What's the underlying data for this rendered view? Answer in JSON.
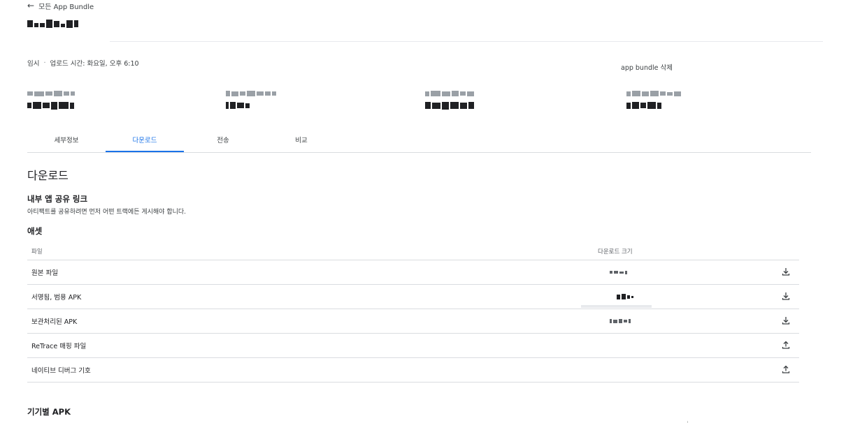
{
  "header": {
    "back_label": "모든 App Bundle",
    "back_icon": "arrow-left-icon"
  },
  "meta": {
    "status": "임시",
    "separator": "·",
    "upload_time": "업로드 시간: 화요일, 오후 6:10"
  },
  "actions": {
    "delete_bundle": "app bundle 삭제"
  },
  "tabs": [
    {
      "label": "세부정보",
      "active": false
    },
    {
      "label": "다운로드",
      "active": true
    },
    {
      "label": "전송",
      "active": false
    },
    {
      "label": "비교",
      "active": false
    }
  ],
  "downloads": {
    "title": "다운로드",
    "share_link": {
      "title": "내부 앱 공유 링크",
      "description": "아티팩트를 공유하려면 먼저 어떤 트랙에든 게시해야 합니다."
    },
    "assets": {
      "title": "애셋",
      "columns": {
        "file": "파일",
        "download_size": "다운로드 크기"
      },
      "rows": [
        {
          "name": "원본 파일",
          "action_icon": "download-icon"
        },
        {
          "name": "서명됨, 범용 APK",
          "action_icon": "download-icon"
        },
        {
          "name": "보관처리된 APK",
          "action_icon": "download-icon"
        },
        {
          "name": "ReTrace 매핑 파일",
          "action_icon": "upload-icon"
        },
        {
          "name": "네이티브 디버그 기호",
          "action_icon": "upload-icon"
        }
      ]
    },
    "device_apk_title": "기기별 APK"
  },
  "colors": {
    "accent": "#1a73e8",
    "text": "#202124",
    "divider": "#dadce0"
  }
}
